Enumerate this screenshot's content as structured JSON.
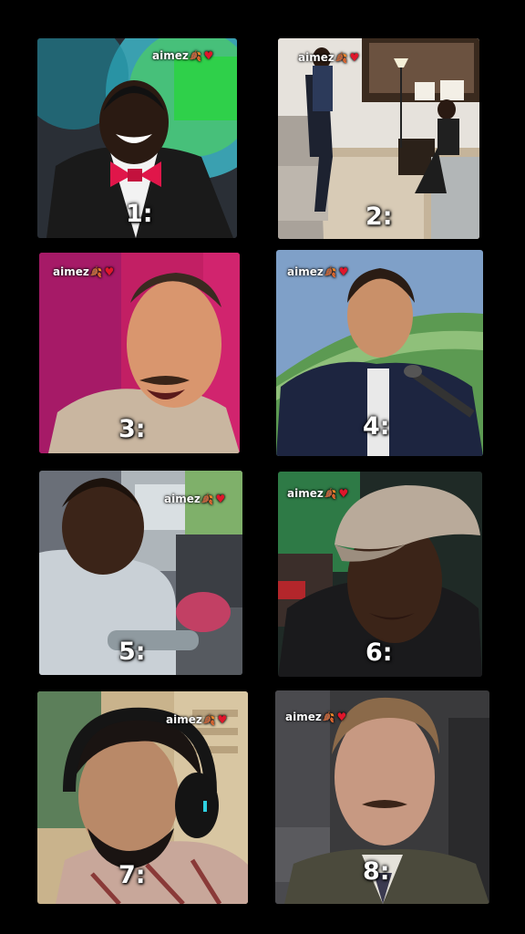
{
  "tiles": [
    {
      "id": 1,
      "watermark": "aimez",
      "number": "1:"
    },
    {
      "id": 2,
      "watermark": "aimez",
      "number": "2:"
    },
    {
      "id": 3,
      "watermark": "aimez",
      "number": "3:"
    },
    {
      "id": 4,
      "watermark": "aimez",
      "number": "4:"
    },
    {
      "id": 5,
      "watermark": "aimez",
      "number": "5:"
    },
    {
      "id": 6,
      "watermark": "aimez",
      "number": "6:"
    },
    {
      "id": 7,
      "watermark": "aimez",
      "number": "7:"
    },
    {
      "id": 8,
      "watermark": "aimez",
      "number": "8:"
    }
  ],
  "icons": {
    "leaf": "leaf-icon",
    "heart": "heart-icon"
  },
  "colors": {
    "background": "#000000",
    "heart": "#e0162b"
  }
}
